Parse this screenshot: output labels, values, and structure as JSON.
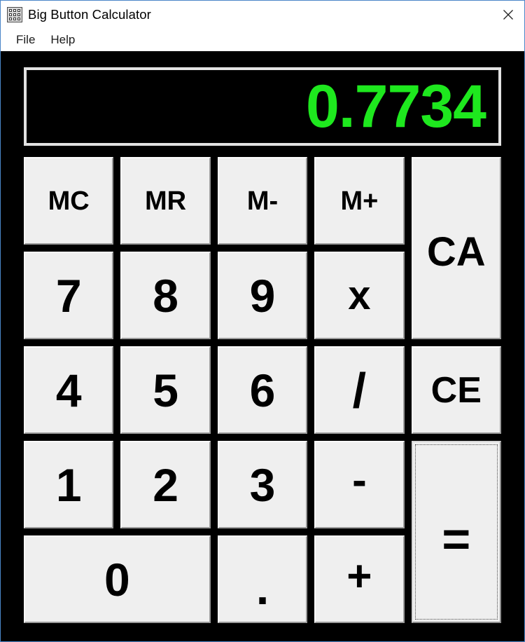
{
  "window": {
    "title": "Big Button Calculator",
    "icon": "calculator-grid-icon",
    "close_label": "✕",
    "border_color": "#4a86c8"
  },
  "menubar": {
    "items": [
      {
        "label": "File"
      },
      {
        "label": "Help"
      }
    ]
  },
  "display": {
    "value": "0.7734",
    "text_color": "#1ee81e",
    "background_color": "#000000",
    "frame_color": "#e2e2e2"
  },
  "keypad": {
    "background_color": "#000000",
    "key_face_color": "#efefef",
    "keys": [
      {
        "id": "mc",
        "label": "MC"
      },
      {
        "id": "mr",
        "label": "MR"
      },
      {
        "id": "mminus",
        "label": "M-"
      },
      {
        "id": "mplus",
        "label": "M+"
      },
      {
        "id": "ca",
        "label": "CA"
      },
      {
        "id": "7",
        "label": "7"
      },
      {
        "id": "8",
        "label": "8"
      },
      {
        "id": "9",
        "label": "9"
      },
      {
        "id": "times",
        "label": "x"
      },
      {
        "id": "4",
        "label": "4"
      },
      {
        "id": "5",
        "label": "5"
      },
      {
        "id": "6",
        "label": "6"
      },
      {
        "id": "divide",
        "label": "/"
      },
      {
        "id": "ce",
        "label": "CE"
      },
      {
        "id": "1",
        "label": "1"
      },
      {
        "id": "2",
        "label": "2"
      },
      {
        "id": "3",
        "label": "3"
      },
      {
        "id": "minus",
        "label": "-"
      },
      {
        "id": "equals",
        "label": "="
      },
      {
        "id": "0",
        "label": "0"
      },
      {
        "id": "dot",
        "label": "."
      },
      {
        "id": "plus",
        "label": "+"
      }
    ]
  }
}
